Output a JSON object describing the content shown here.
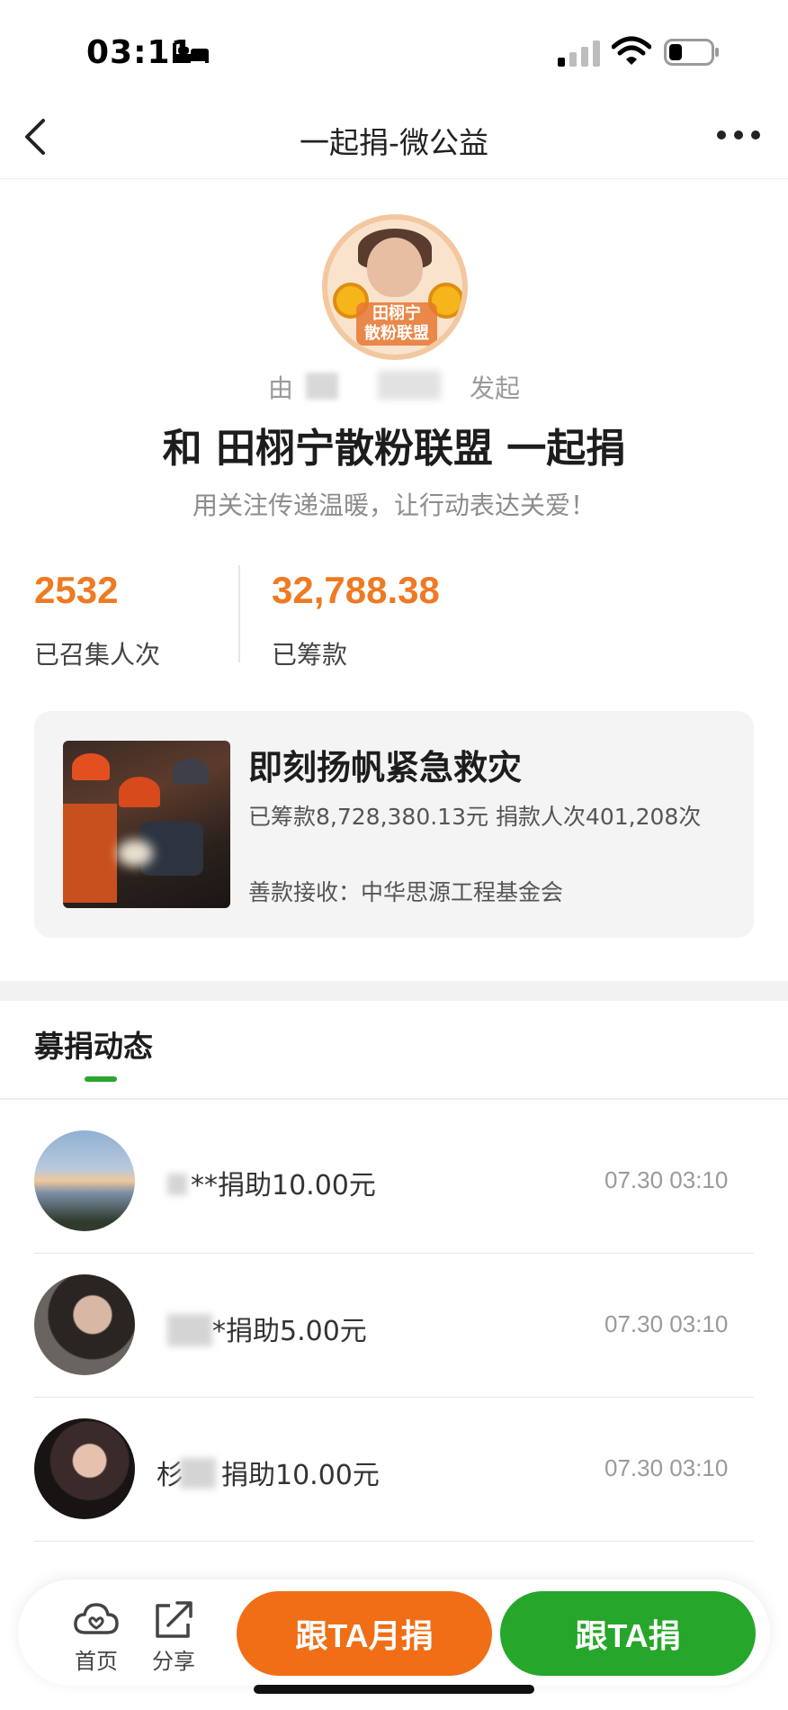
{
  "status_bar": {
    "time": "03:11",
    "battery_level": 0.3
  },
  "nav": {
    "title": "一起捐-微公益"
  },
  "profile": {
    "avatar_text": "田栩宁\n散粉联盟",
    "initiator_prefix": "由",
    "initiator_suffix": "发起",
    "title": "和 田栩宁散粉联盟 一起捐",
    "slogan": "用关注传递温暖，让行动表达关爱！"
  },
  "stats": {
    "participants_value": "2532",
    "participants_label": "已召集人次",
    "raised_value": "32,788.38",
    "raised_label": "已筹款"
  },
  "project": {
    "title": "即刻扬帆紧急救灾",
    "stats_text": "已筹款8,728,380.13元  捐款人次401,208次",
    "receiver": "善款接收：中华思源工程基金会"
  },
  "feed": {
    "title": "募捐动态",
    "items": [
      {
        "name_suffix": "**",
        "action": "捐助10.00元",
        "time": "07.30 03:10"
      },
      {
        "name_suffix": "*",
        "action": "捐助5.00元",
        "time": "07.30 03:10"
      },
      {
        "name_suffix": "杉",
        "action": "捐助10.00元",
        "time": "07.30 03:10"
      }
    ]
  },
  "bottom_bar": {
    "home_label": "首页",
    "share_label": "分享",
    "monthly_button": "跟TA月捐",
    "donate_button": "跟TA捐"
  },
  "colors": {
    "accent_orange": "#ee7a23",
    "monthly_button": "#f06e16",
    "donate_button": "#26a62a",
    "tab_indicator": "#2aa52e"
  }
}
